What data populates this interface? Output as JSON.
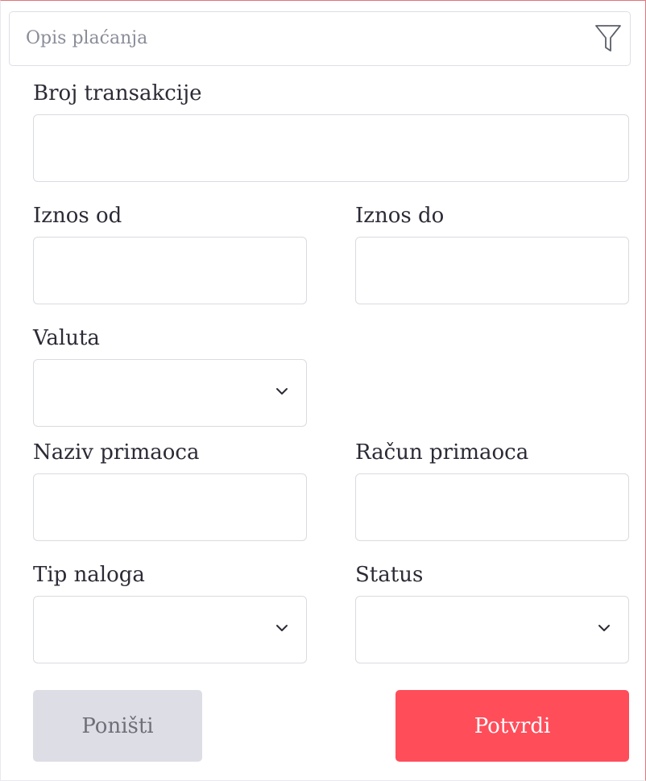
{
  "search": {
    "placeholder": "Opis plaćanja"
  },
  "form": {
    "transaction_number_label": "Broj transakcije",
    "amount_from_label": "Iznos od",
    "amount_to_label": "Iznos do",
    "currency_label": "Valuta",
    "recipient_name_label": "Naziv primaoca",
    "recipient_account_label": "Račun primaoca",
    "order_type_label": "Tip naloga",
    "status_label": "Status"
  },
  "buttons": {
    "reset_label": "Poništi",
    "submit_label": "Potvrdi"
  },
  "colors": {
    "accent": "#ff4d5a",
    "reset_bg": "#dcdde5",
    "border": "#d9dbe1",
    "frame_accent": "#e2757c"
  },
  "icons": {
    "filter": "filter-icon",
    "dropdown": "chevron-down-icon"
  }
}
